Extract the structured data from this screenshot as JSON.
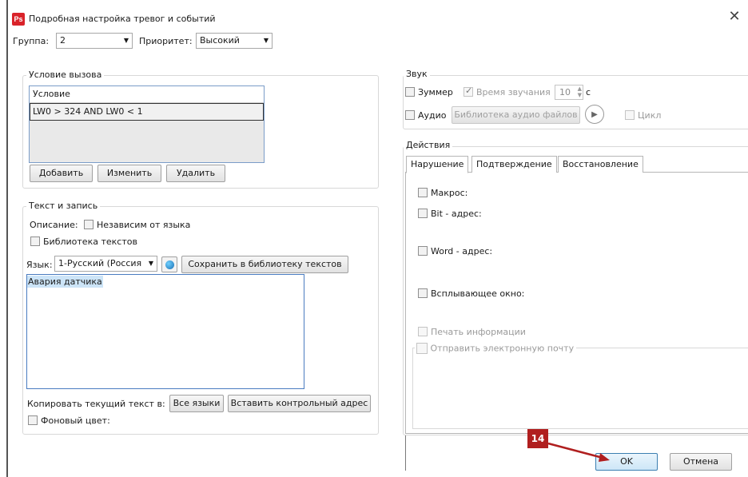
{
  "window": {
    "title": "Подробная настройка тревог и событий",
    "icon_text": "Ps",
    "close": "✕"
  },
  "top": {
    "group_label": "Группа:",
    "group_value": "2",
    "priority_label": "Приоритет:",
    "priority_value": "Высокий"
  },
  "condition": {
    "legend": "Условие вызова",
    "header": "Условие",
    "rows": [
      "LW0 > 324 AND LW0 < 1"
    ],
    "add": "Добавить",
    "edit": "Изменить",
    "delete": "Удалить"
  },
  "text": {
    "legend": "Текст и запись",
    "description_label": "Описание:",
    "lang_independent": "Независим от языка",
    "text_library": "Библиотека текстов",
    "language_label": "Язык:",
    "language_value": "1-Русский (Россия",
    "save_to_library": "Сохранить в библиотеку текстов",
    "content": "Авария датчика",
    "copy_label": "Копировать текущий текст в:",
    "all_languages": "Все языки",
    "insert_address": "Вставить контрольный адрес",
    "bg_color": "Фоновый цвет:"
  },
  "sound": {
    "legend": "Звук",
    "buzzer": "Зуммер",
    "duration_label": "Время звучания",
    "duration_value": "10",
    "duration_unit": "с",
    "audio": "Аудио",
    "audio_library": "Библиотека аудио файлов",
    "loop": "Цикл"
  },
  "actions": {
    "legend": "Действия",
    "tabs": [
      "Нарушение",
      "Подтверждение",
      "Восстановление"
    ],
    "macro": "Макрос:",
    "bit_address": "Bit - адрес:",
    "word_address": "Word - адрес:",
    "popup": "Всплывающее окно:",
    "print": "Печать информации",
    "email": "Отправить электронную почту"
  },
  "footer": {
    "ok": "OK",
    "cancel": "Отмена"
  },
  "annotation": {
    "number": "14",
    "color": "#b01f1f"
  }
}
